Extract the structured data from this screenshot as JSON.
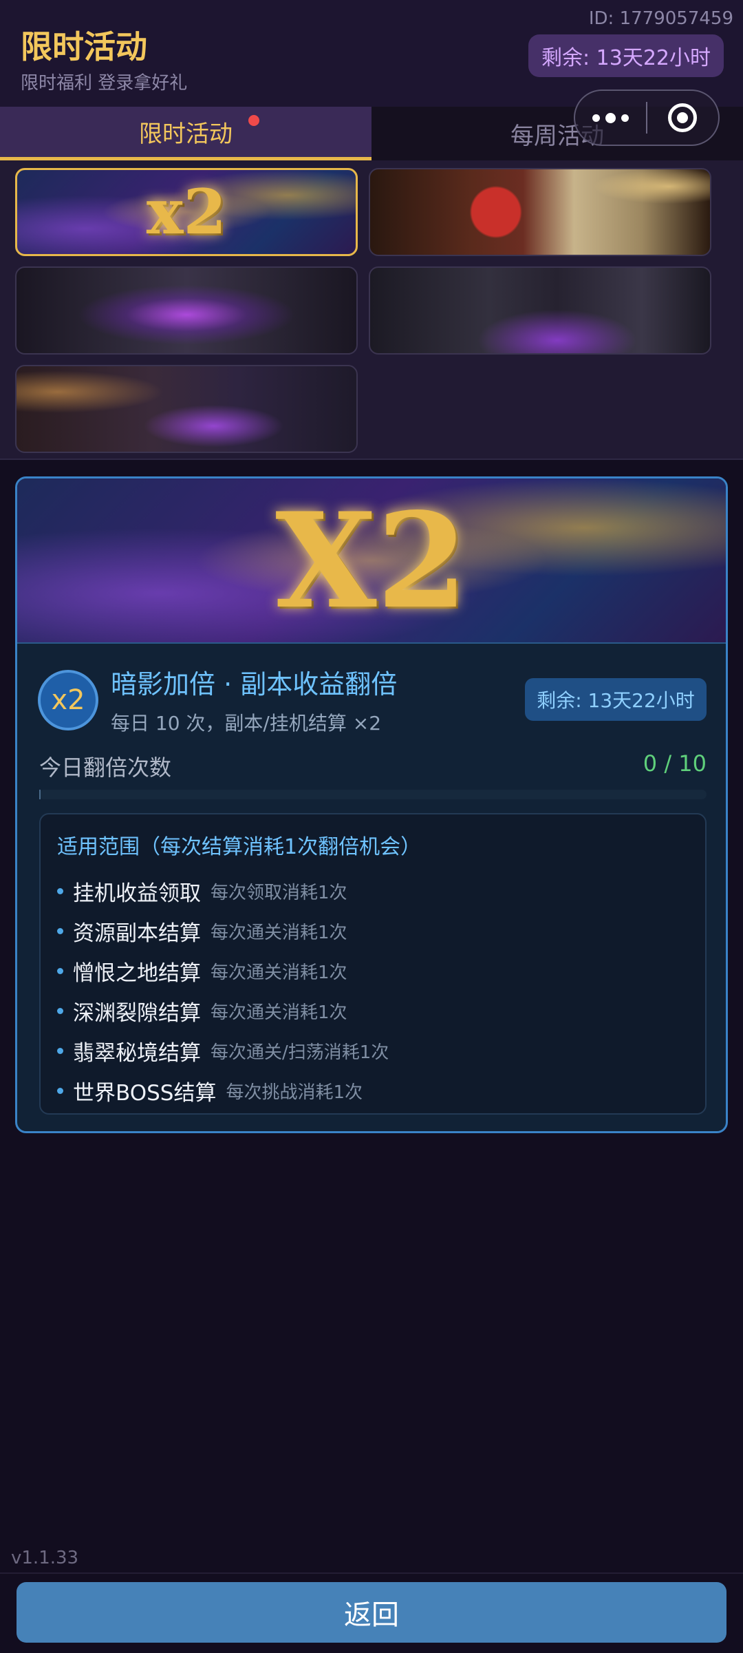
{
  "header": {
    "user_id": "ID: 1779057459",
    "title": "限时活动",
    "subtitle": "限时福利 登录拿好礼",
    "remaining": "剩余: 13天22小时"
  },
  "capsule": {
    "more_icon": "more-dots-icon",
    "close_icon": "target-close-icon"
  },
  "tabs": [
    {
      "label": "限时活动",
      "active": true,
      "has_dot": true
    },
    {
      "label": "每周活动",
      "active": false,
      "has_dot": false
    }
  ],
  "thumbnails": {
    "t1_text": "x2"
  },
  "detail": {
    "banner_text": "X2",
    "badge": "x2",
    "title": "暗影加倍 · 副本收益翻倍",
    "description": "每日 10 次，副本/挂机结算 ×2",
    "remaining": "剩余: 13天22小时",
    "count_label": "今日翻倍次数",
    "count_value": "0 / 10",
    "progress": 0,
    "scope_title": "适用范围（每次结算消耗1次翻倍机会）",
    "scope_items": [
      {
        "name": "挂机收益领取",
        "note": "每次领取消耗1次"
      },
      {
        "name": "资源副本结算",
        "note": "每次通关消耗1次"
      },
      {
        "name": "憎恨之地结算",
        "note": "每次通关消耗1次"
      },
      {
        "name": "深渊裂隙结算",
        "note": "每次通关消耗1次"
      },
      {
        "name": "翡翠秘境结算",
        "note": "每次通关/扫荡消耗1次"
      },
      {
        "name": "世界BOSS结算",
        "note": "每次挑战消耗1次"
      }
    ]
  },
  "footer": {
    "version": "v1.1.33",
    "back_label": "返回"
  },
  "colors": {
    "accent_gold": "#f3c75c",
    "accent_blue": "#3a83c8",
    "success_green": "#5fd07b",
    "back_button": "#4682b8"
  }
}
